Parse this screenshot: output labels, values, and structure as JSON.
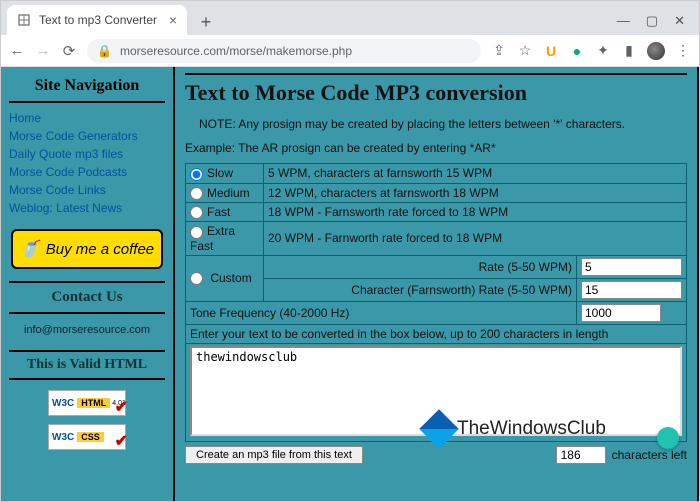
{
  "browser": {
    "tab_title": "Text to mp3 Converter",
    "url": "morseresource.com/morse/makemorse.php"
  },
  "sidebar": {
    "heading": "Site Navigation",
    "links": [
      "Home",
      "Morse Code Generators",
      "Daily Quote mp3 files",
      "Morse Code Podcasts",
      "Morse Code Links",
      "Weblog: Latest News"
    ],
    "buy_label": "Buy me a coffee",
    "contact_heading": "Contact Us",
    "contact_email": "info@morseresource.com",
    "valid_heading": "This is Valid HTML",
    "badge_html_a": "W3C",
    "badge_html_b": "HTML",
    "badge_html_c": "4.01",
    "badge_css_a": "W3C",
    "badge_css_b": "CSS"
  },
  "main": {
    "title": "Text to Morse Code MP3 conversion",
    "note": "NOTE: Any prosign may be created by placing the letters between '*' characters.",
    "example": "Example: The AR prosign can be created by entering *AR*",
    "speeds": [
      {
        "label": "Slow",
        "desc": "5 WPM, characters at farnsworth 15 WPM",
        "checked": true
      },
      {
        "label": "Medium",
        "desc": "12 WPM, characters at farnsworth 18 WPM",
        "checked": false
      },
      {
        "label": "Fast",
        "desc": "18 WPM - Farnsworth rate forced to 18 WPM",
        "checked": false
      },
      {
        "label": "Extra Fast",
        "desc": "20 WPM - Farnworth rate forced to 18 WPM",
        "checked": false
      }
    ],
    "custom_label": "Custom",
    "rate_label": "Rate (5-50 WPM)",
    "rate_value": "5",
    "farns_label": "Character (Farnsworth) Rate (5-50 WPM)",
    "farns_value": "15",
    "tone_label": "Tone Frequency (40-2000 Hz)",
    "tone_value": "1000",
    "enter_label": "Enter your text to be converted in the box below, up to 200 characters in length",
    "textarea_value": "thewindowsclub",
    "create_button": "Create an mp3 file from this text",
    "chars_left_value": "186",
    "chars_left_label": "characters left",
    "overlay_text": "TheWindowsClub"
  }
}
